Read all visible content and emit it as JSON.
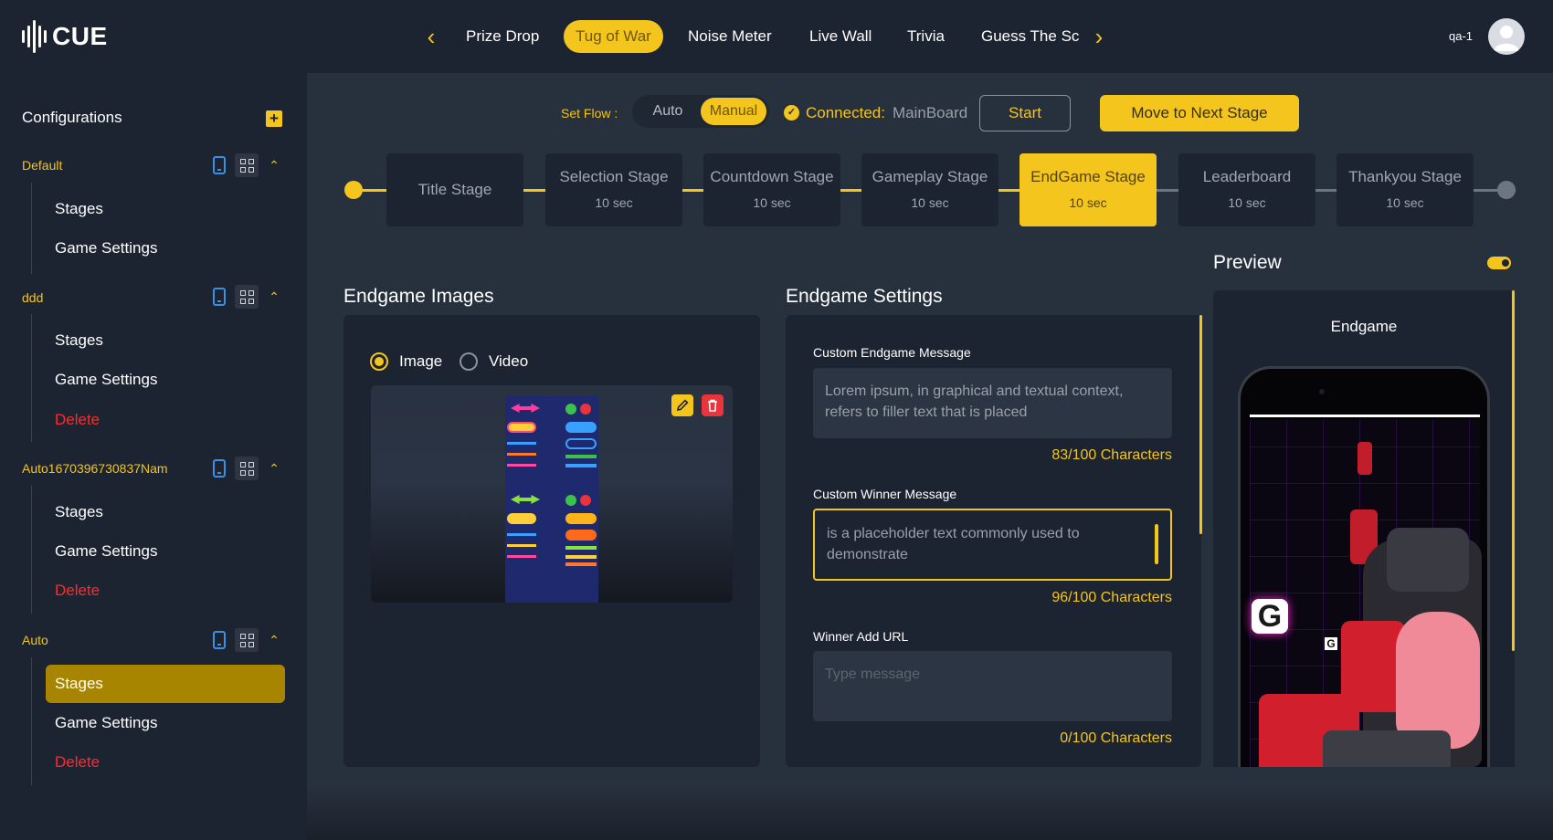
{
  "brand": {
    "name": "CUE"
  },
  "nav": {
    "tabs": [
      {
        "label": "Prize Drop",
        "active": false
      },
      {
        "label": "Tug of War",
        "active": true
      },
      {
        "label": "Noise Meter",
        "active": false
      },
      {
        "label": "Live Wall",
        "active": false
      },
      {
        "label": "Trivia",
        "active": false
      },
      {
        "label": "Guess The Sc",
        "active": false
      }
    ],
    "prev_icon": "chevron-left-icon",
    "next_icon": "chevron-right-icon"
  },
  "user": {
    "name": "qa-1",
    "avatar_icon": "user-avatar-icon"
  },
  "sidebar": {
    "title": "Configurations",
    "add_icon": "plus-icon",
    "configs": [
      {
        "name": "Default",
        "items": [
          "Stages",
          "Game Settings"
        ]
      },
      {
        "name": "ddd",
        "items": [
          "Stages",
          "Game Settings",
          "Delete"
        ]
      },
      {
        "name": "Auto1670396730837Nam",
        "items": [
          "Stages",
          "Game Settings",
          "Delete"
        ]
      },
      {
        "name": "Auto",
        "items": [
          "Stages",
          "Game Settings",
          "Delete"
        ],
        "active_item": "Stages"
      }
    ]
  },
  "flow": {
    "label": "Set Flow :",
    "options": [
      "Auto",
      "Manual"
    ],
    "selected": "Manual",
    "connected_label": "Connected:",
    "connected_board": "MainBoard",
    "start_label": "Start",
    "next_stage_label": "Move to Next Stage"
  },
  "stages": [
    {
      "name": "Title Stage",
      "time": ""
    },
    {
      "name": "Selection Stage",
      "time": "10 sec"
    },
    {
      "name": "Countdown Stage",
      "time": "10 sec"
    },
    {
      "name": "Gameplay Stage",
      "time": "10 sec"
    },
    {
      "name": "EndGame Stage",
      "time": "10 sec"
    },
    {
      "name": "Leaderboard",
      "time": "10 sec"
    },
    {
      "name": "Thankyou Stage",
      "time": "10 sec"
    }
  ],
  "active_stage": "EndGame Stage",
  "images": {
    "title": "Endgame Images",
    "options": [
      "Image",
      "Video"
    ],
    "selected": "Image",
    "edit_icon": "pencil-icon",
    "delete_icon": "trash-icon"
  },
  "settings": {
    "title": "Endgame Settings",
    "fields": [
      {
        "label": "Custom Endgame Message",
        "value": "Lorem ipsum, in graphical and textual context, refers to filler text that is placed",
        "placeholder": "",
        "counter": "83/100 Characters"
      },
      {
        "label": "Custom Winner Message",
        "value": "is a placeholder text commonly used to demonstrate",
        "placeholder": "",
        "counter": "96/100 Characters"
      },
      {
        "label": "Winner Add URL",
        "value": "",
        "placeholder": "Type message",
        "counter": "0/100 Characters"
      }
    ]
  },
  "preview": {
    "title": "Preview",
    "screen_title": "Endgame",
    "toggle_on": true
  }
}
